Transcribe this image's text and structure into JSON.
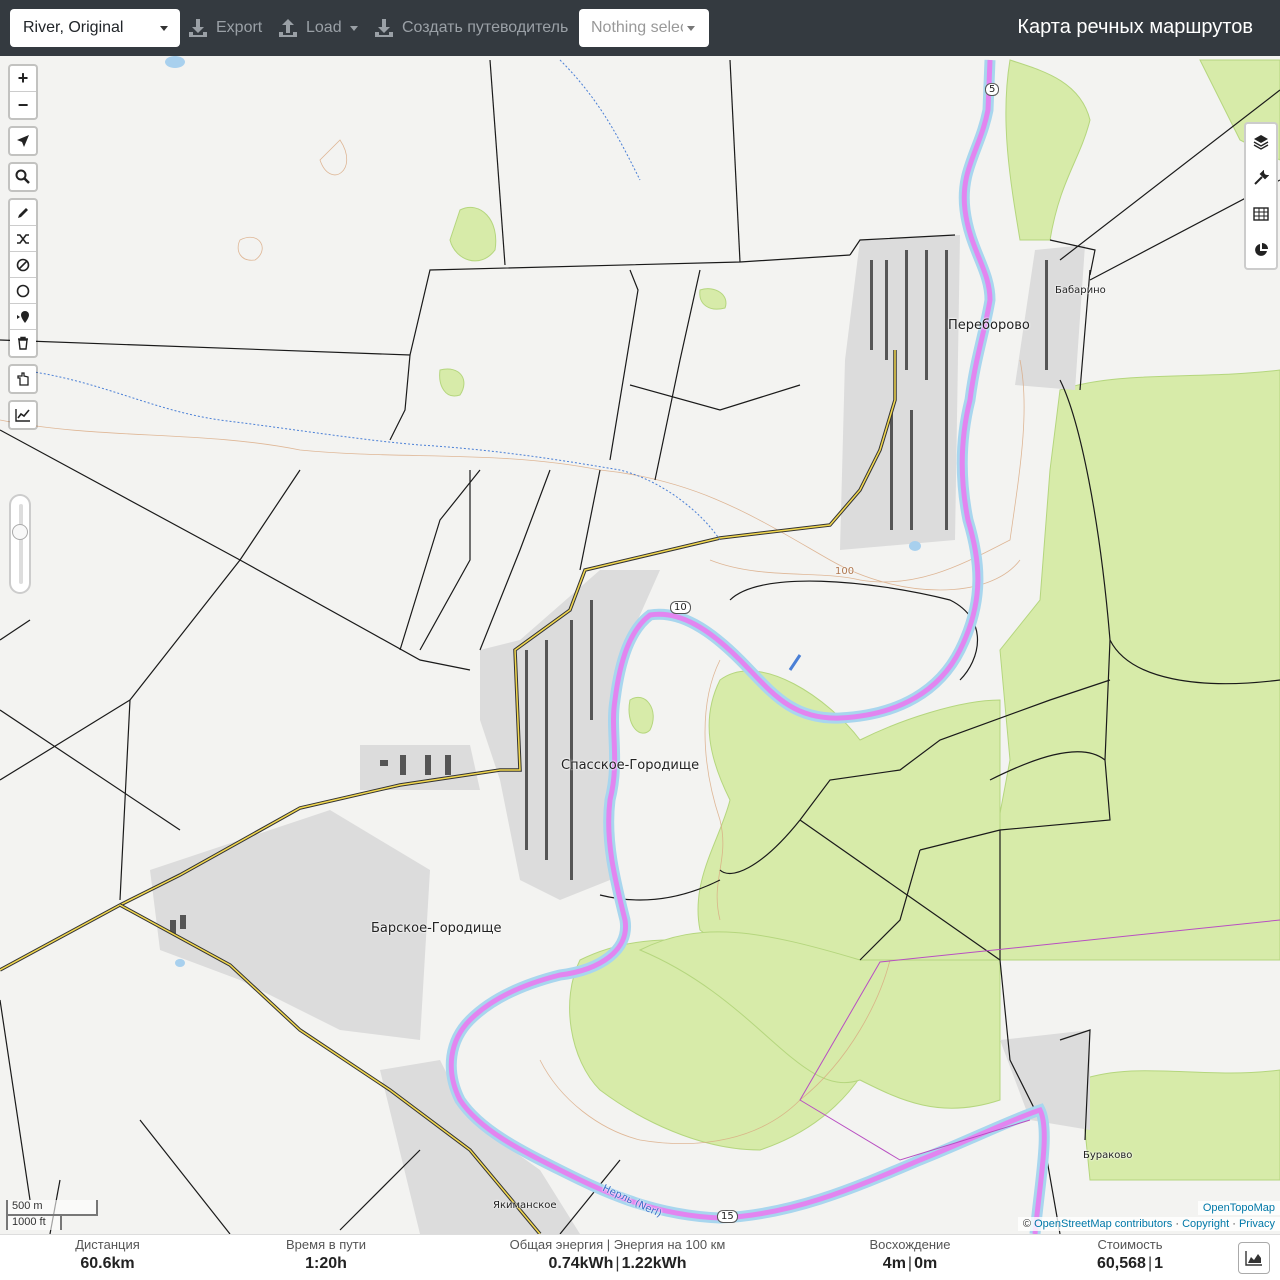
{
  "navbar": {
    "profile": "River, Original",
    "export_label": "Export",
    "load_label": "Load",
    "guide_label": "Создать путеводитель",
    "route_select_placeholder": "Nothing selected",
    "title": "Карта речных маршрутов"
  },
  "map": {
    "places": {
      "pereborovo": "Переборово",
      "babarino": "Бабарино",
      "spasskoe": "Спасское-Городище",
      "barskoe": "Барское-Городище",
      "yakimanskoe": "Якиманское",
      "burakovo": "Бураково"
    },
    "road_numbers": [
      "5",
      "10",
      "15"
    ],
    "river_labels": [
      "Нерль (Nerl)"
    ],
    "contour_labels": [
      "100"
    ],
    "scale": {
      "metric": "500 m",
      "imperial": "1000 ft"
    },
    "attribution": {
      "tiles": "OpenTopoMap",
      "copyright_prefix": "©",
      "osm": "OpenStreetMap contributors",
      "copyright": "Copyright",
      "privacy": "Privacy",
      "separator": "·"
    },
    "colors": {
      "route": "#e87cf0",
      "river": "#a8d8f0",
      "forest": "#d6eba8"
    }
  },
  "controls": {
    "zoom_in": "+",
    "zoom_out": "−"
  },
  "stats": {
    "distance": {
      "label": "Дистанция",
      "value": "60.6",
      "unit": "km"
    },
    "time": {
      "label": "Время в пути",
      "value": "1:20",
      "unit": "h"
    },
    "energy": {
      "label": "Общая энергия | Энергия на 100 км",
      "value1": "0.74",
      "unit1": "kWh",
      "value2": "1.22",
      "unit2": "kWh"
    },
    "ascent": {
      "label": "Восхождение",
      "value1": "4",
      "unit1": "m",
      "value2": "0",
      "unit2": "m"
    },
    "cost": {
      "label": "Стоимость",
      "value1": "60,568",
      "value2": "1"
    },
    "separator": "|"
  }
}
